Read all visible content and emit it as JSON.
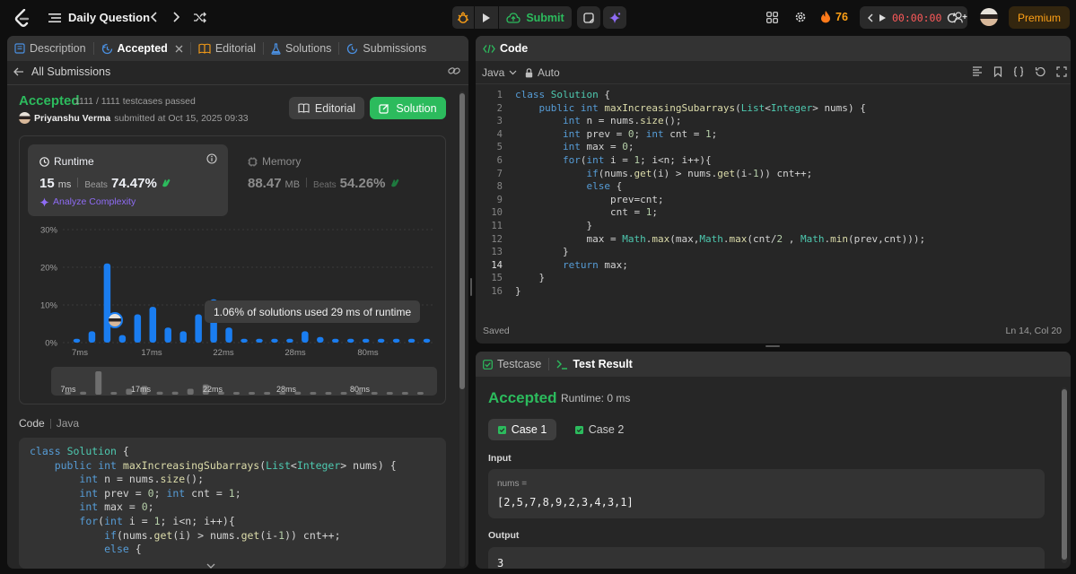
{
  "nav": {
    "title": "Daily Question",
    "submit_label": "Submit",
    "streak": "76",
    "timer": "00:00:00",
    "premium": "Premium"
  },
  "left": {
    "tabs": [
      {
        "label": "Description"
      },
      {
        "label": "Accepted"
      },
      {
        "label": "Editorial"
      },
      {
        "label": "Solutions"
      },
      {
        "label": "Submissions"
      }
    ],
    "back_label": "All Submissions",
    "status": "Accepted",
    "testcases": "1111 / 1111 testcases passed",
    "user": "Priyanshu Verma",
    "submitted": "submitted at Oct 15, 2025 09:33",
    "editorial_btn": "Editorial",
    "solution_btn": "Solution",
    "runtime": {
      "label": "Runtime",
      "value": "15",
      "unit": "ms",
      "beats_label": "Beats",
      "beats": "74.47%",
      "analyze": "Analyze Complexity"
    },
    "memory": {
      "label": "Memory",
      "value": "88.47",
      "unit": "MB",
      "beats_label": "Beats",
      "beats": "54.26%"
    },
    "tooltip": "1.06% of solutions used 29 ms of runtime",
    "code_label": "Code",
    "code_lang": "Java"
  },
  "chart_data": {
    "type": "bar",
    "ylabels": [
      "30%",
      "20%",
      "10%",
      "0%"
    ],
    "xlabels": [
      "7ms",
      "17ms",
      "22ms",
      "28ms",
      "80ms"
    ],
    "ylim": [
      0,
      30
    ],
    "values": [
      1,
      3,
      21,
      2,
      7.5,
      9.5,
      4,
      3,
      7.5,
      11.5,
      4,
      1,
      1,
      1,
      1,
      3,
      1.5,
      1,
      1,
      1,
      1,
      1,
      1,
      1
    ],
    "mini_values": [
      1,
      2,
      16,
      1,
      4,
      6,
      2,
      2,
      4,
      7,
      2,
      1,
      1,
      1,
      1,
      2,
      1,
      1,
      1,
      1,
      1,
      1,
      1,
      1
    ]
  },
  "right": {
    "code_tab": "Code",
    "lang": "Java",
    "auto": "Auto",
    "saved": "Saved",
    "cursor": "Ln 14, Col 20",
    "testcase_tab": "Testcase",
    "result_tab": "Test Result",
    "result_status": "Accepted",
    "result_runtime": "Runtime: 0 ms",
    "cases": [
      "Case 1",
      "Case 2"
    ],
    "input_label": "Input",
    "param_name": "nums =",
    "param_value": "[2,5,7,8,9,2,3,4,3,1]",
    "output_label": "Output",
    "output_value": "3"
  },
  "code_lines": [
    "class Solution {",
    "    public int maxIncreasingSubarrays(List<Integer> nums) {",
    "        int n = nums.size();",
    "        int prev = 0; int cnt = 1;",
    "        int max = 0;",
    "        for(int i = 1; i<n; i++){",
    "            if(nums.get(i) > nums.get(i-1)) cnt++;",
    "            else {",
    "                prev=cnt;",
    "                cnt = 1;",
    "            }",
    "            max = Math.max(max,Math.max(cnt/2 , Math.min(prev,cnt)));",
    "        }",
    "        return max;",
    "    }",
    "}"
  ],
  "colors": {
    "accent_green": "#2cbb5d",
    "blue_bar": "#1a7df0",
    "orange": "#ffa116"
  }
}
